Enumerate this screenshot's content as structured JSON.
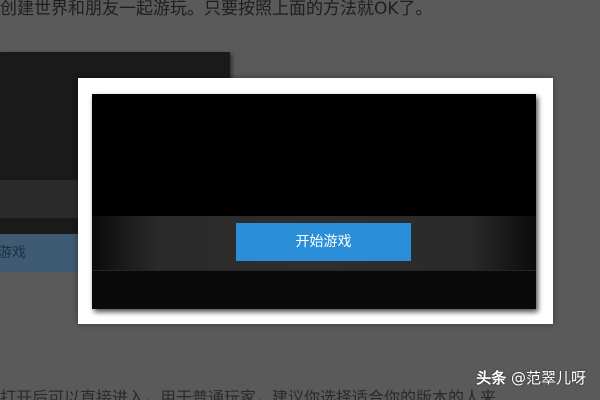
{
  "background": {
    "article_line_top": "创建世界和朋友一起游玩。只要按照上面的方法就OK了。",
    "article_line_bottom": "打开后可以直接进入，用于普通玩家，建议你选择适合你的版本的人来",
    "bg_button_label": "游戏"
  },
  "modal": {
    "start_button_label": "开始游戏"
  },
  "watermark": {
    "brand": "头条",
    "handle": "@范翠儿呀"
  },
  "colors": {
    "start_button": "#2a8fd8",
    "page_background": "#5a5a5a",
    "game_background": "#000000"
  }
}
